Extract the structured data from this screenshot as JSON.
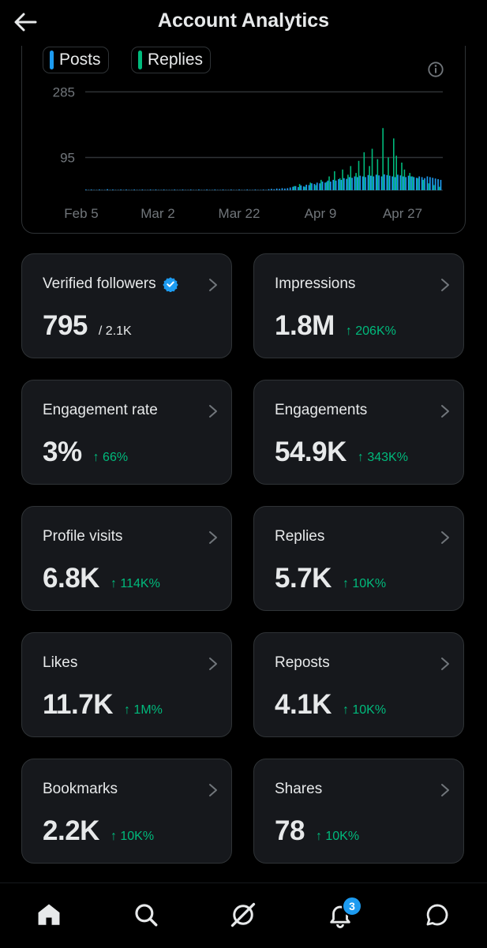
{
  "header": {
    "title": "Account Analytics"
  },
  "chart": {
    "legend": [
      {
        "label": "Posts",
        "color": "#1d9bf0"
      },
      {
        "label": "Replies",
        "color": "#00ba7c"
      }
    ]
  },
  "chart_data": {
    "type": "bar",
    "title": "",
    "xlabel": "",
    "ylabel": "",
    "ylim": [
      0,
      320
    ],
    "yticks": [
      95,
      285
    ],
    "xtick_labels": [
      "Feb 5",
      "Mar 2",
      "Mar 22",
      "Apr 9",
      "Apr 27"
    ],
    "series": [
      {
        "name": "Posts",
        "color": "#1d9bf0",
        "values": [
          2,
          1,
          2,
          1,
          1,
          2,
          1,
          1,
          3,
          1,
          2,
          1,
          1,
          2,
          1,
          2,
          1,
          1,
          2,
          1,
          1,
          2,
          1,
          1,
          2,
          1,
          2,
          1,
          1,
          2,
          1,
          1,
          1,
          2,
          1,
          1,
          2,
          1,
          1,
          2,
          1,
          1,
          2,
          1,
          1,
          2,
          1,
          1,
          2,
          1,
          1,
          2,
          1,
          1,
          2,
          1,
          1,
          2,
          1,
          1,
          2,
          1,
          1,
          2,
          1,
          1,
          2,
          1,
          3,
          4,
          3,
          5,
          4,
          6,
          5,
          6,
          8,
          10,
          12,
          9,
          14,
          11,
          16,
          15,
          20,
          18,
          22,
          20,
          25,
          22,
          28,
          25,
          30,
          28,
          32,
          30,
          35,
          33,
          38,
          36,
          40,
          38,
          42,
          40,
          38,
          44,
          42,
          40,
          45,
          43,
          40,
          46,
          44,
          42,
          40,
          38,
          45,
          43,
          40,
          38,
          42,
          40,
          38,
          36,
          40,
          38,
          35,
          40,
          38,
          36,
          34,
          32,
          30
        ]
      },
      {
        "name": "Replies",
        "color": "#00ba7c",
        "values": [
          0,
          0,
          0,
          0,
          0,
          0,
          0,
          0,
          0,
          0,
          0,
          0,
          0,
          0,
          0,
          0,
          0,
          0,
          0,
          0,
          0,
          0,
          0,
          0,
          0,
          0,
          0,
          0,
          0,
          0,
          0,
          0,
          0,
          0,
          0,
          0,
          0,
          0,
          0,
          0,
          0,
          0,
          0,
          0,
          0,
          0,
          0,
          0,
          0,
          0,
          0,
          0,
          0,
          0,
          0,
          0,
          0,
          0,
          0,
          0,
          0,
          0,
          0,
          0,
          0,
          0,
          0,
          0,
          0,
          0,
          0,
          0,
          0,
          0,
          0,
          0,
          0,
          12,
          0,
          18,
          0,
          10,
          0,
          22,
          0,
          15,
          0,
          30,
          0,
          24,
          40,
          0,
          55,
          0,
          35,
          60,
          0,
          45,
          70,
          0,
          50,
          85,
          0,
          110,
          0,
          70,
          120,
          0,
          90,
          0,
          180,
          0,
          95,
          0,
          150,
          100,
          0,
          80,
          60,
          0,
          50,
          40,
          0,
          35,
          0,
          30,
          0,
          20,
          0,
          15,
          0,
          10,
          0
        ]
      }
    ]
  },
  "stats": [
    {
      "label": "Verified followers",
      "value": "795",
      "sub": "/ 2.1K",
      "verified": true
    },
    {
      "label": "Impressions",
      "value": "1.8M",
      "delta": "↑ 206K%"
    },
    {
      "label": "Engagement rate",
      "value": "3%",
      "delta": "↑ 66%"
    },
    {
      "label": "Engagements",
      "value": "54.9K",
      "delta": "↑ 343K%"
    },
    {
      "label": "Profile visits",
      "value": "6.8K",
      "delta": "↑ 114K%"
    },
    {
      "label": "Replies",
      "value": "5.7K",
      "delta": "↑ 10K%"
    },
    {
      "label": "Likes",
      "value": "11.7K",
      "delta": "↑ 1M%"
    },
    {
      "label": "Reposts",
      "value": "4.1K",
      "delta": "↑ 10K%"
    },
    {
      "label": "Bookmarks",
      "value": "2.2K",
      "delta": "↑ 10K%"
    },
    {
      "label": "Shares",
      "value": "78",
      "delta": "↑ 10K%"
    }
  ],
  "nav": {
    "items": [
      "home-icon",
      "search-icon",
      "grok-icon",
      "notifications-icon",
      "messages-icon"
    ],
    "notifications_badge": "3"
  }
}
